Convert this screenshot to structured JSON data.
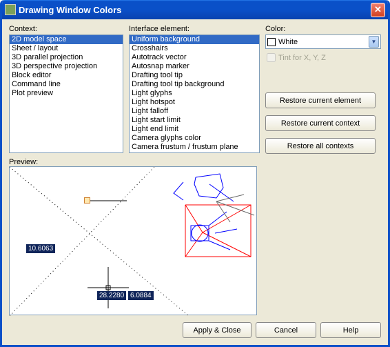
{
  "window": {
    "title": "Drawing Window Colors"
  },
  "labels": {
    "context": "Context:",
    "iface": "Interface element:",
    "color": "Color:",
    "tint": "Tint for X, Y, Z",
    "preview": "Preview:"
  },
  "context_items": [
    "2D model space",
    "Sheet / layout",
    "3D parallel projection",
    "3D perspective projection",
    "Block editor",
    "Command line",
    "Plot preview"
  ],
  "context_selected": 0,
  "iface_items": [
    "Uniform background",
    "Crosshairs",
    "Autotrack vector",
    "Autosnap marker",
    "Drafting tool tip",
    "Drafting tool tip background",
    "Light glyphs",
    "Light hotspot",
    "Light falloff",
    "Light start limit",
    "Light end limit",
    "Camera glyphs color",
    "Camera frustum / frustum plane"
  ],
  "iface_selected": 0,
  "color_combo": {
    "value": "White",
    "swatch": "#FFFFFF"
  },
  "buttons": {
    "restore_element": "Restore current element",
    "restore_context": "Restore current context",
    "restore_all": "Restore all contexts",
    "apply_close": "Apply & Close",
    "cancel": "Cancel",
    "help": "Help"
  },
  "preview_readouts": {
    "dim_y": "10.6063",
    "dim_x1": "28.2280",
    "dim_x2": "6.0884"
  }
}
